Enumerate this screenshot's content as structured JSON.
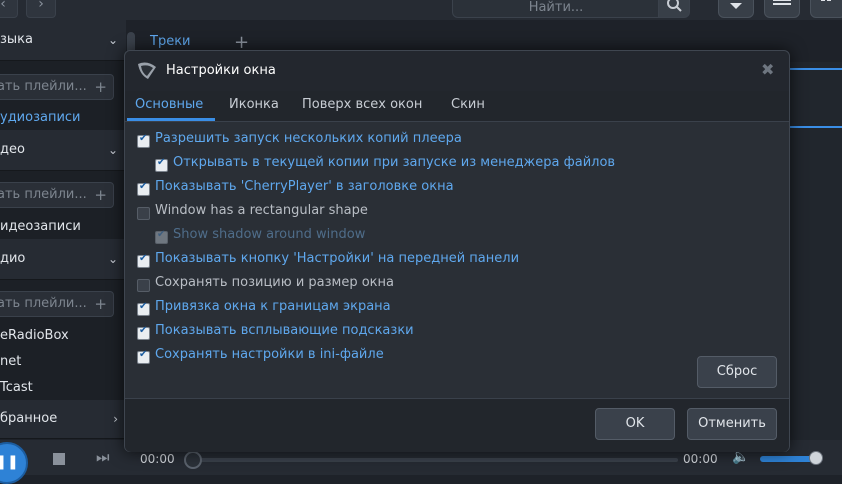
{
  "topbar": {
    "back": "‹",
    "forward": "›",
    "search_placeholder": "Найти...",
    "download_icon": "download-icon",
    "eq_icon": "equalizer-icon",
    "grid_icon": "grid-icon"
  },
  "sidebar": {
    "music_header": "зыка",
    "music_input": "ать плейли...",
    "audio_link": "удиозаписи",
    "video_header": "део",
    "video_input": "ать плейли...",
    "video_link": "идеозаписи",
    "radio_header": "дио",
    "radio_input": "ать плейли...",
    "radio_items": [
      "eRadioBox",
      "net",
      "Tcast"
    ],
    "favorites": "бранное",
    "chevron_down": "⌄",
    "chevron_right": "›",
    "plus": "+"
  },
  "main": {
    "tracks_tab": "Треки",
    "add_tab": "+"
  },
  "dialog": {
    "title": "Настройки окна",
    "close": "✖",
    "tabs": [
      "Основные",
      "Иконка",
      "Поверх всех окон",
      "Скин"
    ],
    "options": [
      {
        "label": "Разрешить запуск нескольких копий плеера",
        "state": "checked"
      },
      {
        "label": "Открывать в текущей копии при запуске из менеджера файлов",
        "state": "checked"
      },
      {
        "label": "Показывать 'CherryPlayer' в заголовке окна",
        "state": "checked"
      },
      {
        "label": "Window has a rectangular shape",
        "state": "unchecked"
      },
      {
        "label": "Show shadow around window",
        "state": "disabled"
      },
      {
        "label": "Показывать кнопку 'Настройки' на передней панели",
        "state": "checked"
      },
      {
        "label": "Сохранять позицию и размер окна",
        "state": "unchecked"
      },
      {
        "label": "Привязка окна к границам экрана",
        "state": "checked"
      },
      {
        "label": "Показывать всплывающие подсказки",
        "state": "checked"
      },
      {
        "label": "Сохранять настройки в ini-файле",
        "state": "checked"
      }
    ],
    "reset_label": "Сброс",
    "ok_label": "OK",
    "cancel_label": "Отменить"
  },
  "player": {
    "time_current": "00:00",
    "time_total": "00:00",
    "volume_level": 0.85,
    "pause_symbol": "❚❚",
    "next_symbol": "⏭",
    "volume_symbol": "🔈"
  },
  "colors": {
    "accent": "#5fa8ee",
    "dialog_bg": "#2a2f36",
    "app_bg": "#1e2229"
  }
}
